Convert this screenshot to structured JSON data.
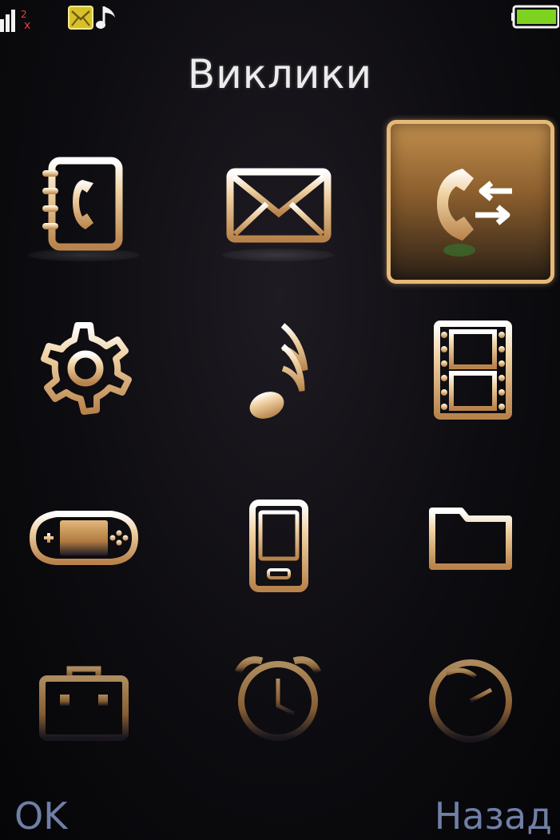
{
  "screen": {
    "title": "Виклики",
    "accent_color": "#e6b979",
    "background_color": "#0d0c10"
  },
  "status_bar": {
    "icons": [
      "signal-strength-icon",
      "message-status-icon",
      "music-note-status-icon",
      "battery-icon"
    ],
    "battery_color": "#7ed321"
  },
  "menu": {
    "selected_index": 2,
    "items": [
      {
        "icon": "phonebook-icon"
      },
      {
        "icon": "messages-icon"
      },
      {
        "icon": "calls-icon"
      },
      {
        "icon": "settings-gear-icon"
      },
      {
        "icon": "music-note-icon"
      },
      {
        "icon": "video-film-icon"
      },
      {
        "icon": "games-console-icon"
      },
      {
        "icon": "phone-device-icon"
      },
      {
        "icon": "folder-icon"
      },
      {
        "icon": "toolbox-icon"
      },
      {
        "icon": "alarm-clock-icon"
      },
      {
        "icon": "clock-icon"
      }
    ]
  },
  "softkeys": {
    "left_label": "OK",
    "right_label": "Назад"
  }
}
